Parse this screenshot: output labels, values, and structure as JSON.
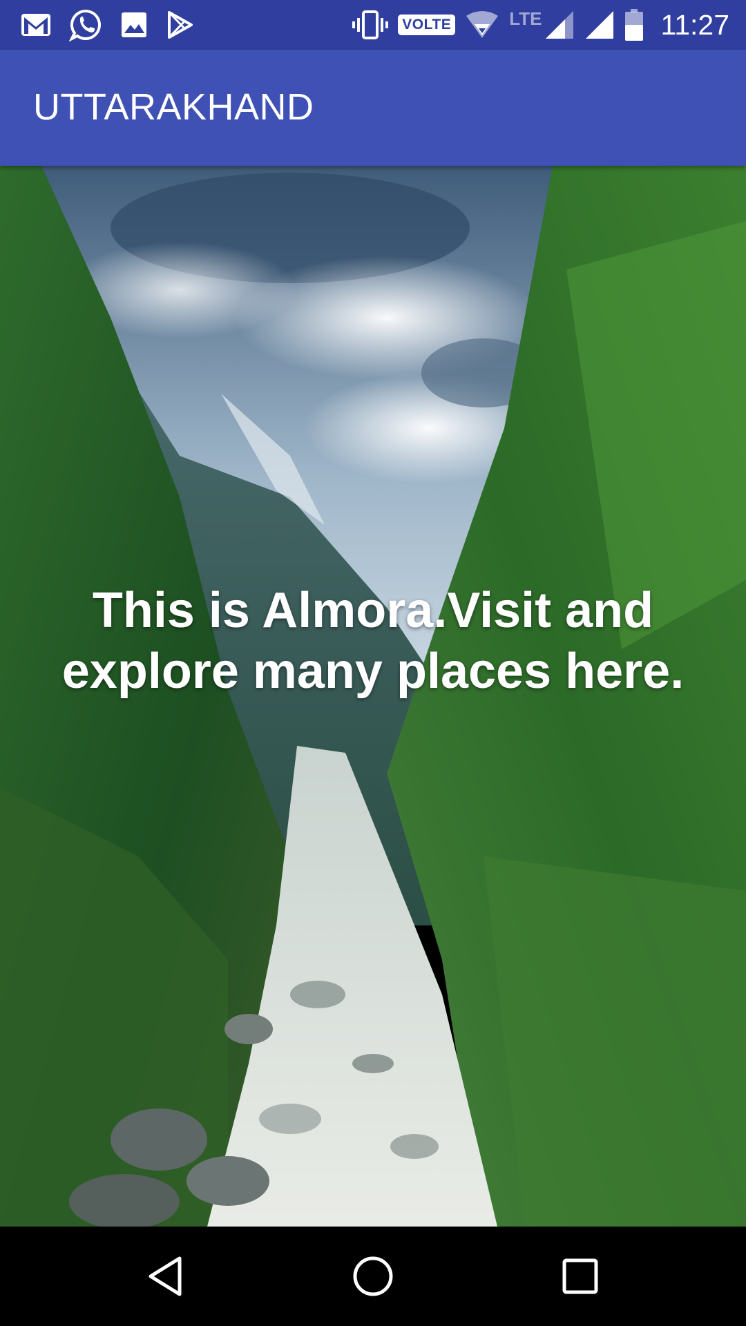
{
  "status_bar": {
    "left_icons": [
      "gmail-icon",
      "whatsapp-icon",
      "gallery-icon",
      "play-store-icon"
    ],
    "right_icons": [
      "vibrate-icon",
      "volte-badge",
      "wifi-hotspot-icon",
      "lte-signal-icon",
      "signal-icon",
      "battery-icon"
    ],
    "volte_label": "VOLTE",
    "lte_label": "LTE",
    "time": "11:27",
    "background_color": "#303f9f"
  },
  "app_bar": {
    "title": "UTTARAKHAND",
    "background_color": "#3f51b5"
  },
  "content": {
    "caption": "This is Almora.Visit and explore many places here.",
    "background_image": "mountain-valley-river-photo"
  },
  "nav_bar": {
    "buttons": [
      "back-icon",
      "home-icon",
      "recents-icon"
    ]
  }
}
